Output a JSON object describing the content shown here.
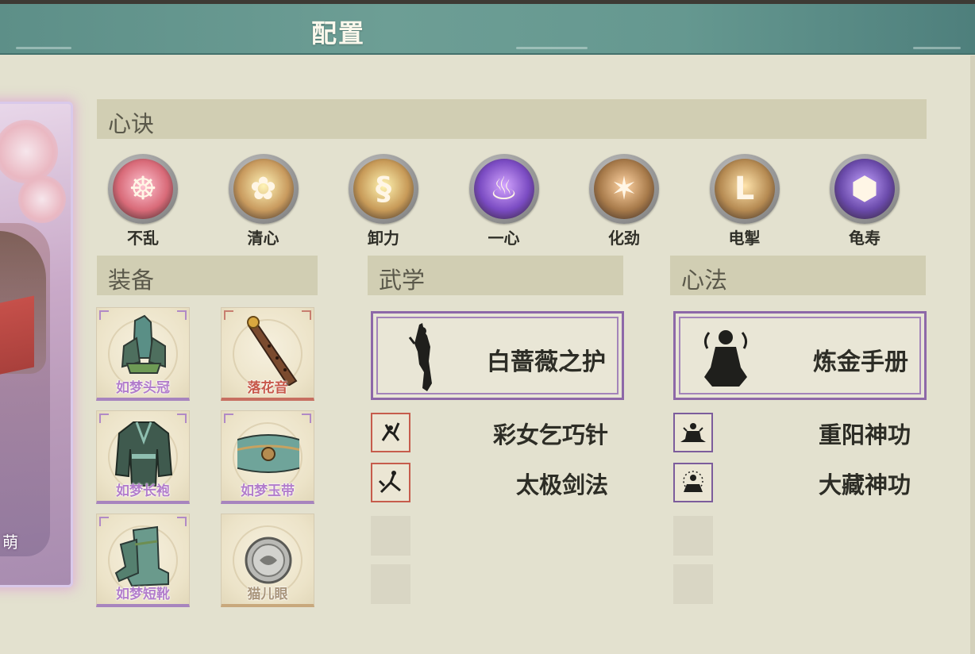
{
  "header": {
    "title": "配置"
  },
  "character": {
    "name_partial": "萌"
  },
  "sections": {
    "heart_formula": "心诀",
    "equipment": "装备",
    "martial_arts": "武学",
    "mental_method": "心法"
  },
  "heart_formula_skills": [
    {
      "label": "不乱",
      "icon": "meditating-figure-icon",
      "color": "#d86a78"
    },
    {
      "label": "清心",
      "icon": "lotus-icon",
      "color": "#c89a5e"
    },
    {
      "label": "卸力",
      "icon": "swirl-icon",
      "color": "#c79a58"
    },
    {
      "label": "一心",
      "icon": "purple-flame-icon",
      "color": "#7a4bc2"
    },
    {
      "label": "化劲",
      "icon": "spark-burst-icon",
      "color": "#a77a4a"
    },
    {
      "label": "电掣",
      "icon": "lightning-icon",
      "color": "#b58a52"
    },
    {
      "label": "龟寿",
      "icon": "turtle-shell-icon",
      "color": "#6a4aaa"
    }
  ],
  "equipment": [
    {
      "label": "如梦头冠",
      "icon": "crown-icon",
      "quality": "purple"
    },
    {
      "label": "落花音",
      "icon": "flute-icon",
      "quality": "red"
    },
    {
      "label": "如梦长袍",
      "icon": "robe-icon",
      "quality": "purple"
    },
    {
      "label": "如梦玉带",
      "icon": "belt-icon",
      "quality": "purple"
    },
    {
      "label": "如梦短靴",
      "icon": "boots-icon",
      "quality": "purple"
    },
    {
      "label": "猫儿眼",
      "icon": "gem-icon",
      "quality": "tan"
    }
  ],
  "martial_arts": {
    "main": {
      "name": "白蔷薇之护",
      "icon": "dancer-silhouette-icon"
    },
    "slots": [
      {
        "name": "彩女乞巧针",
        "icon": "needle-strike-icon"
      },
      {
        "name": "太极剑法",
        "icon": "sword-stance-icon"
      },
      {
        "name": "",
        "icon": ""
      },
      {
        "name": "",
        "icon": ""
      }
    ]
  },
  "mental_method": {
    "main": {
      "name": "炼金手册",
      "icon": "seated-deity-icon"
    },
    "slots": [
      {
        "name": "重阳神功",
        "icon": "meditation-icon"
      },
      {
        "name": "大藏神功",
        "icon": "buddha-aura-icon"
      },
      {
        "name": "",
        "icon": ""
      },
      {
        "name": "",
        "icon": ""
      }
    ]
  }
}
